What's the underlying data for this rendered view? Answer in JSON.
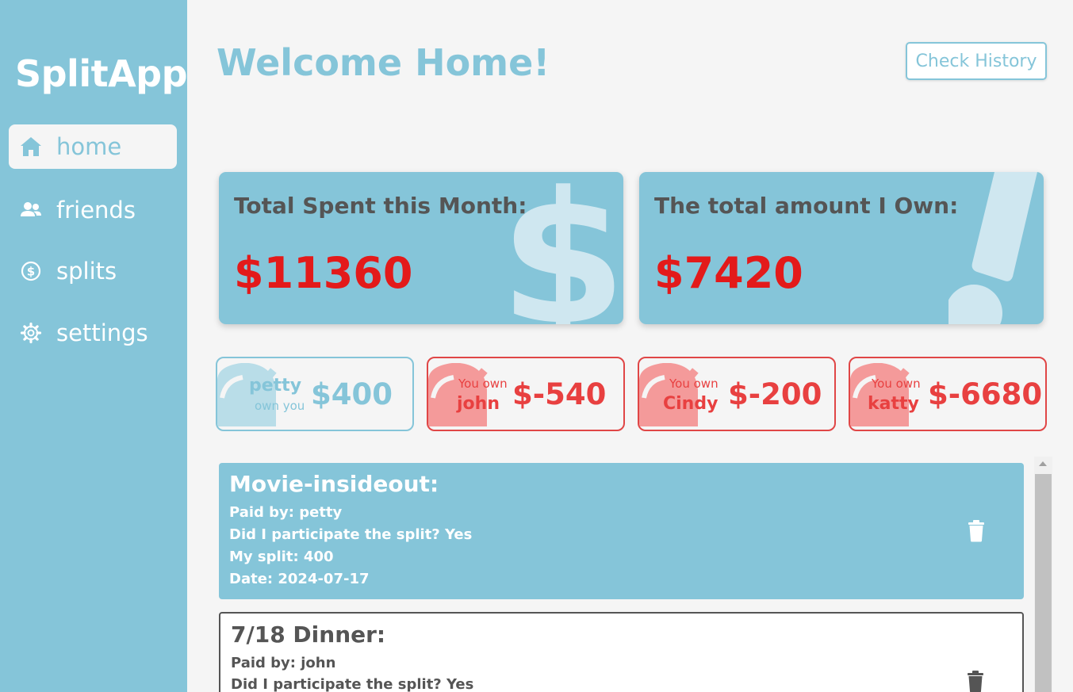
{
  "app": {
    "brand": "SplitApp"
  },
  "sidebar": {
    "items": [
      {
        "label": "home",
        "icon": "home-icon",
        "active": true
      },
      {
        "label": "friends",
        "icon": "users-icon",
        "active": false
      },
      {
        "label": "splits",
        "icon": "dollar-circle-icon",
        "active": false
      },
      {
        "label": "settings",
        "icon": "gear-icon",
        "active": false
      }
    ]
  },
  "header": {
    "title": "Welcome Home!",
    "history_button": "Check History"
  },
  "stats": {
    "spent": {
      "label": "Total Spent this Month:",
      "value": "$11360",
      "watermark": "$"
    },
    "owe": {
      "label": "The total amount I Own:",
      "value": "$7420",
      "watermark": "!"
    }
  },
  "friends": [
    {
      "name": "petty",
      "caption": "own you",
      "amount": "$400",
      "direction": "owes-me"
    },
    {
      "name": "john",
      "caption": "You own",
      "amount": "$-540",
      "direction": "i-owe"
    },
    {
      "name": "Cindy",
      "caption": "You own",
      "amount": "$-200",
      "direction": "i-owe"
    },
    {
      "name": "katty",
      "caption": "You own",
      "amount": "$-6680",
      "direction": "i-owe"
    }
  ],
  "splits": [
    {
      "title": "Movie-insideout:",
      "paid_by": "Paid by: petty",
      "participated": "Did I participate the split? Yes",
      "my_split": "My split: 400",
      "date": "Date: 2024-07-17"
    },
    {
      "title": "7/18 Dinner:",
      "paid_by": "Paid by: john",
      "participated": "Did I participate the split? Yes"
    }
  ],
  "colors": {
    "primary": "#85c5d9",
    "background": "#f5f5f5",
    "danger": "#e84040",
    "amount_red": "#e31a1a",
    "text_dark": "#555555",
    "watermark": "#cfe7f0",
    "bell_blue": "#b9dde8",
    "bell_red": "#f49a9a"
  }
}
